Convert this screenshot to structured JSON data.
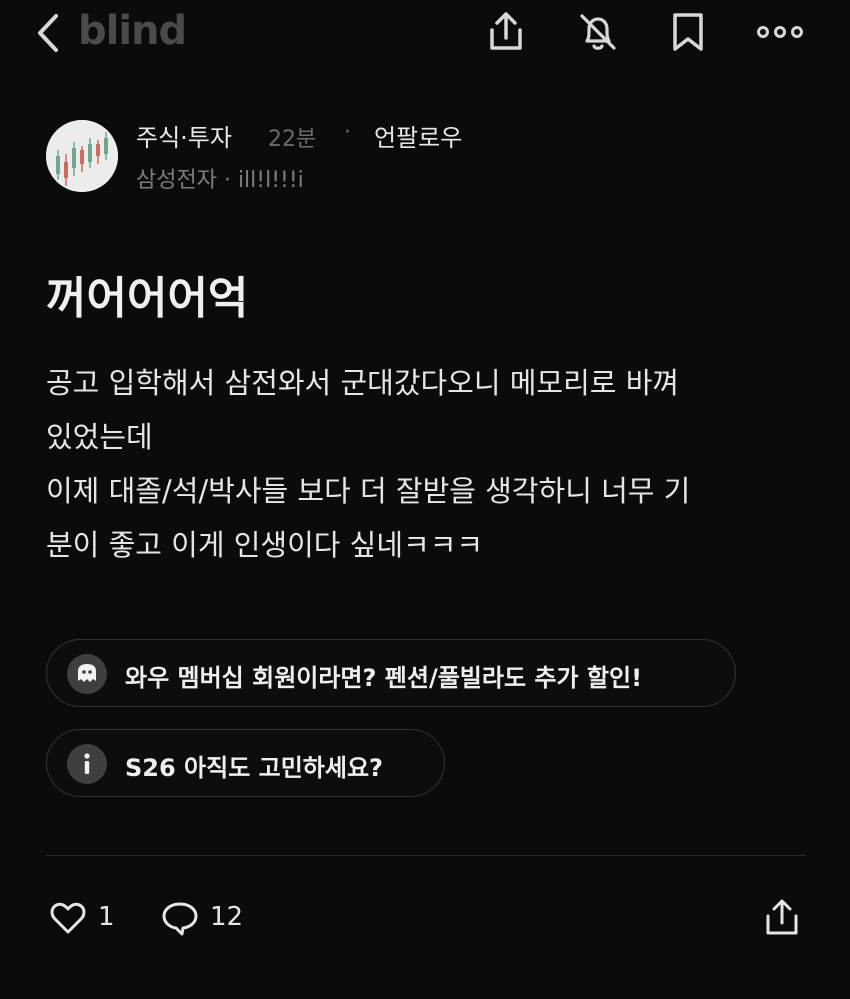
{
  "header": {
    "logo": "blind",
    "icons": [
      "back-icon",
      "share-icon",
      "notification-off-icon",
      "bookmark-icon",
      "more-icon"
    ]
  },
  "post": {
    "channel": "주식·투자",
    "time": "22분",
    "separator": "·",
    "unfollow": "언팔로우",
    "company": "삼성전자 · ill!l!!!i",
    "title": "꺼어어어억",
    "body": [
      "공고 입학해서 삼전와서 군대갔다오니 메모리로 바껴",
      "있었는데",
      "이제 대졸/석/박사들 보다 더 잘받을 생각하니 너무 기",
      "분이 좋고 이게 인생이다 싶네ㅋㅋㅋ"
    ]
  },
  "chips": [
    {
      "text": "와우 멤버십 회원이라면? 펜션/풀빌라도 추가 할인!",
      "icon": "chat-bubble-icon"
    },
    {
      "text": "S26 아직도 고민하세요?",
      "icon": "info-icon"
    }
  ],
  "actions": {
    "likes": "1",
    "comments": "12"
  },
  "colors": {
    "background": "#0b0b0b",
    "text": "#ececec",
    "muted": "#6b6b6b",
    "logo": "#4a4a4a"
  }
}
